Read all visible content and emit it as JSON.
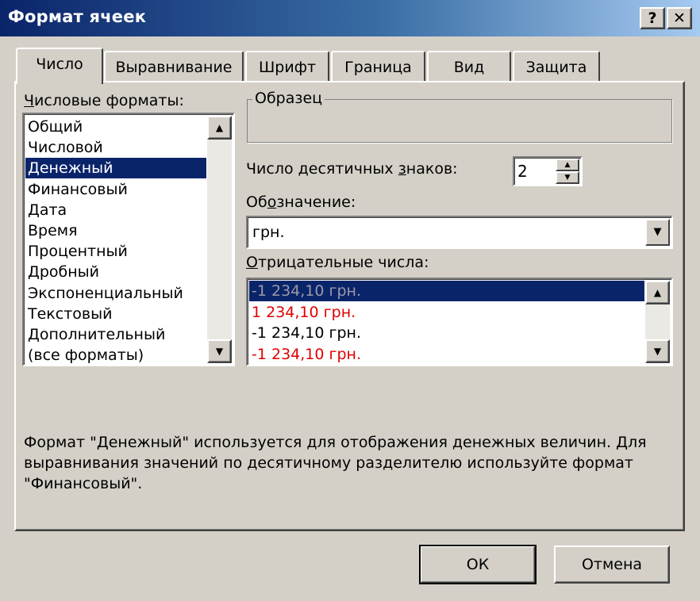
{
  "window": {
    "title": "Формат ячеек",
    "help_label": "?",
    "close_label": "✕"
  },
  "tabs": [
    {
      "label": "Число",
      "active": true
    },
    {
      "label": "Выравнивание",
      "active": false
    },
    {
      "label": "Шрифт",
      "active": false
    },
    {
      "label": "Граница",
      "active": false
    },
    {
      "label": "Вид",
      "active": false
    },
    {
      "label": "Защита",
      "active": false
    }
  ],
  "formats": {
    "label_u": "Ч",
    "label_rest": "исловые форматы:",
    "items": [
      "Общий",
      "Числовой",
      "Денежный",
      "Финансовый",
      "Дата",
      "Время",
      "Процентный",
      "Дробный",
      "Экспоненциальный",
      "Текстовый",
      "Дополнительный",
      "(все форматы)"
    ],
    "selected": "Денежный"
  },
  "sample": {
    "legend": "Образец",
    "value": ""
  },
  "decimals": {
    "label_pre": "Число десятичных ",
    "label_u": "з",
    "label_post": "наков:",
    "value": "2"
  },
  "symbol": {
    "label_pre": "Об",
    "label_u": "о",
    "label_post": "значение:",
    "value": "грн."
  },
  "negative": {
    "label_u": "О",
    "label_rest": "трицательные числа:",
    "items": [
      {
        "text": "-1 234,10 грн.",
        "color": "#000000",
        "selected": true
      },
      {
        "text": "1 234,10 грн.",
        "color": "#e00000",
        "selected": false
      },
      {
        "text": "-1 234,10 грн.",
        "color": "#000000",
        "selected": false
      },
      {
        "text": "-1 234,10 грн.",
        "color": "#e00000",
        "selected": false
      }
    ]
  },
  "description": "Формат \"Денежный\" используется для отображения денежных величин. Для выравнивания значений по десятичному разделителю используйте формат \"Финансовый\".",
  "buttons": {
    "ok": "ОК",
    "cancel": "Отмена"
  },
  "icons": {
    "scroll_up": "scroll-up-arrow-icon",
    "scroll_down": "scroll-down-arrow-icon",
    "dropdown": "dropdown-arrow-icon"
  }
}
